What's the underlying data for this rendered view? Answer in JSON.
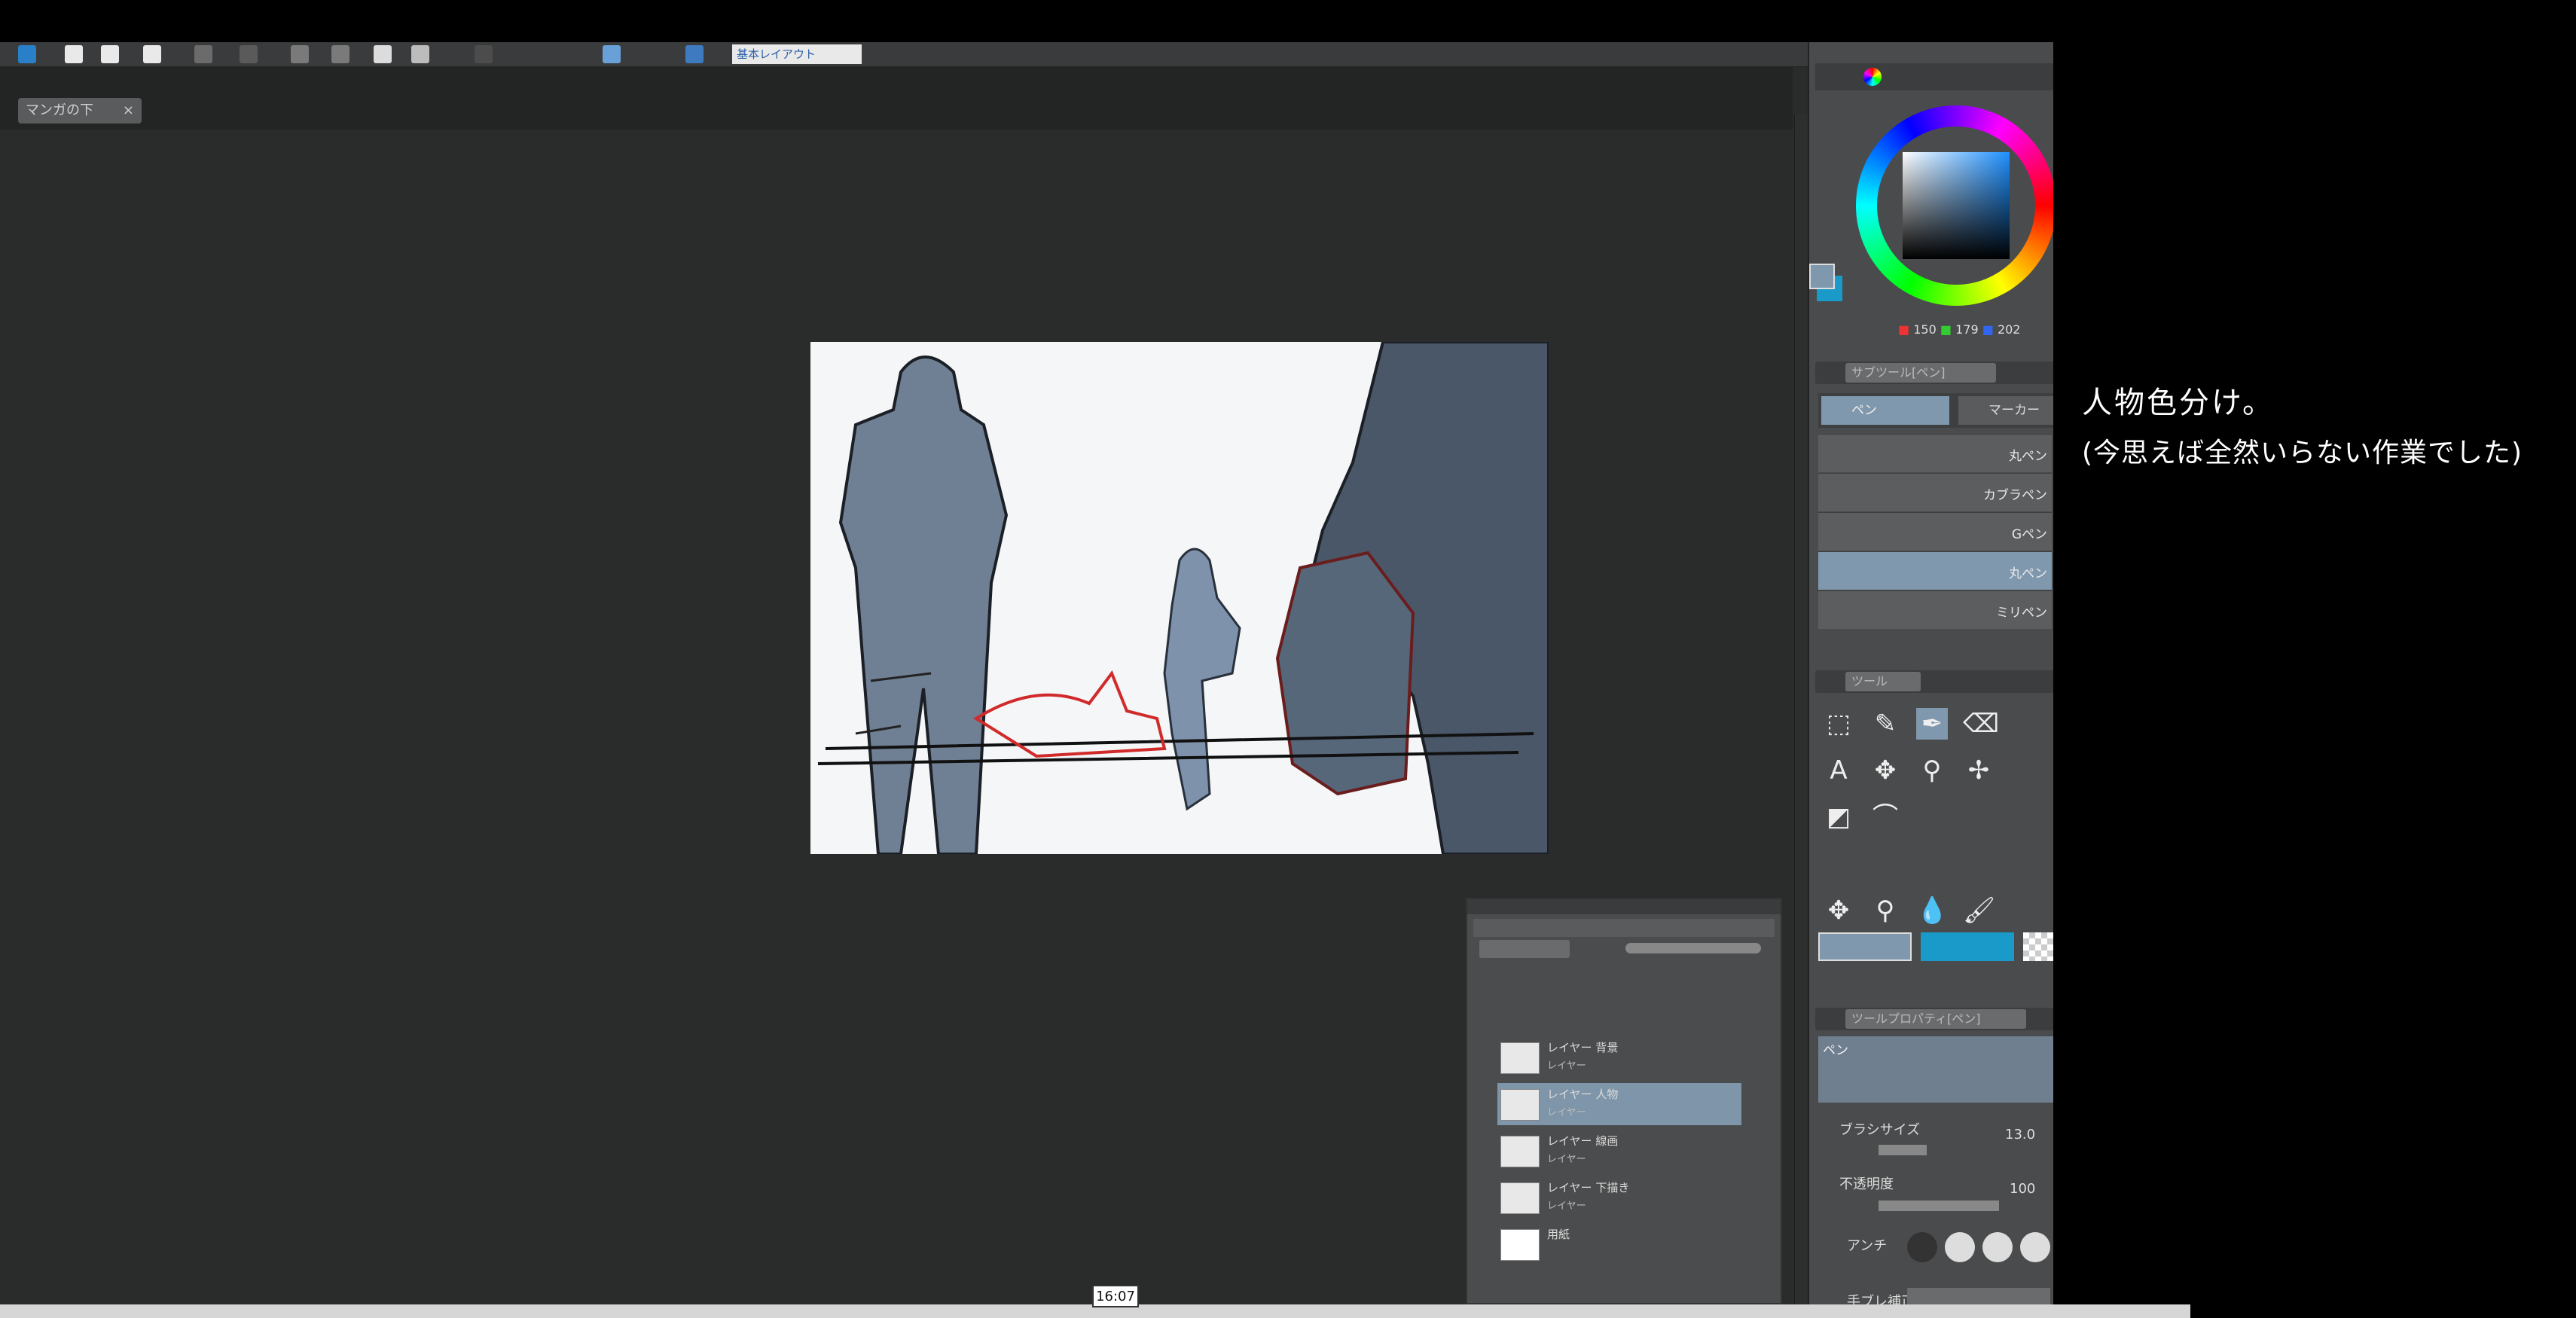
{
  "toolbar": {
    "icons": [
      "app-icon",
      "new-file-icon",
      "open-file-icon",
      "save-icon",
      "undo-icon",
      "redo-icon",
      "select-icon",
      "crop-icon",
      "ruler-icon",
      "transform-icon",
      "pen-select-icon",
      "layer-icon",
      "brush-icon"
    ],
    "layout_field": "基本レイアウト"
  },
  "tab": {
    "label": "マンガの下",
    "close": "×"
  },
  "color_panel": {
    "r": "150",
    "g": "179",
    "b": "202",
    "main_color": "#7f98ae",
    "sub_color": "#1a9ac8"
  },
  "subtool_panel": {
    "title": "サブツール[ペン]",
    "tabs": [
      "ペン",
      "マーカー"
    ],
    "brushes": [
      "丸ペン",
      "カブラペン",
      "Gペン",
      "丸ペン",
      "ミリペン"
    ],
    "selected_index": 3
  },
  "tool_panel": {
    "title": "ツール"
  },
  "tool_property": {
    "title": "ツールプロパティ[ペン]",
    "tool_name": "ペン",
    "brush_size_label": "ブラシサイズ",
    "brush_size_value": "13.0",
    "opacity_label": "不透明度",
    "opacity_value": "100",
    "antialias_label": "アンチ",
    "stabilize_label": "手ブレ補正"
  },
  "layers": [
    {
      "name": "レイヤー 背景",
      "mode": "レイヤー",
      "selected": false
    },
    {
      "name": "レイヤー 人物",
      "mode": "レイヤー",
      "selected": true
    },
    {
      "name": "レイヤー 線画",
      "mode": "レイヤー",
      "selected": false
    },
    {
      "name": "レイヤー 下描き",
      "mode": "レイヤー",
      "selected": false
    },
    {
      "name": "用紙",
      "mode": "",
      "selected": false
    }
  ],
  "captions": {
    "line1": "人物色分け。",
    "line2": "(今思えば全然いらない作業でした)"
  },
  "video": {
    "timestamp": "16:07"
  }
}
